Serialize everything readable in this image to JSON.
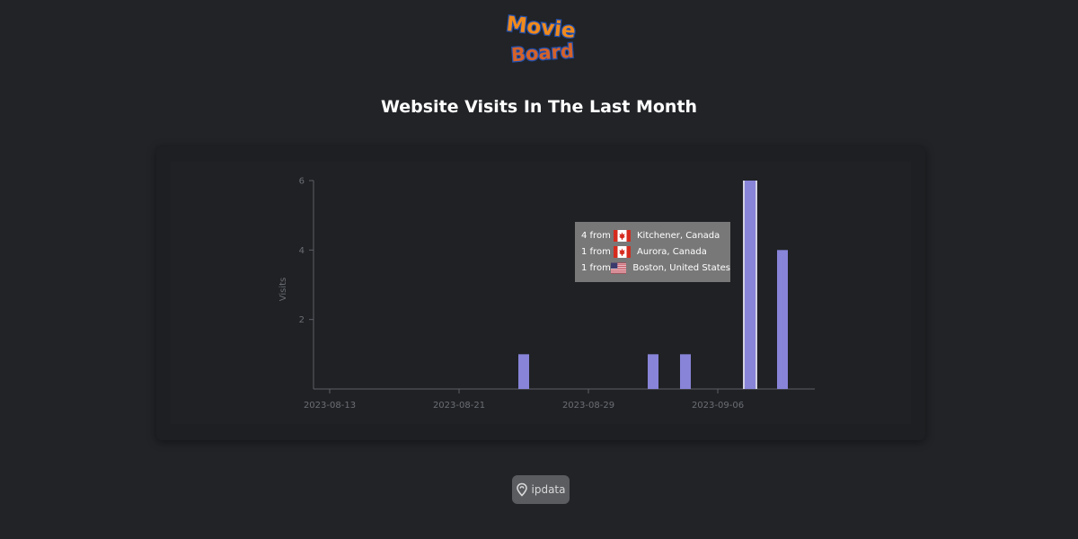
{
  "logo": {
    "line1": "Movie",
    "line2": "Board"
  },
  "page_title": "Website Visits In The Last Month",
  "chart_data": {
    "type": "bar",
    "title": "Website Visits In The Last Month",
    "xlabel": "",
    "ylabel": "Visits",
    "x_ticks": [
      "2023-08-13",
      "2023-08-21",
      "2023-08-29",
      "2023-09-06"
    ],
    "y_ticks": [
      2,
      4,
      6
    ],
    "ylim": [
      0,
      6
    ],
    "x_range": [
      "2023-08-12",
      "2023-09-12"
    ],
    "bars": [
      {
        "date": "2023-08-25",
        "value": 1
      },
      {
        "date": "2023-09-02",
        "value": 1
      },
      {
        "date": "2023-09-04",
        "value": 1
      },
      {
        "date": "2023-09-08",
        "value": 6,
        "highlighted": true
      },
      {
        "date": "2023-09-10",
        "value": 4
      }
    ],
    "bar_color": "#8884d8",
    "grid": false
  },
  "tooltip": {
    "rows": [
      {
        "count": "4 from",
        "flag": "canada-flag-icon",
        "location": "Kitchener, Canada"
      },
      {
        "count": "1 from",
        "flag": "canada-flag-icon",
        "location": "Aurora, Canada"
      },
      {
        "count": "1 from",
        "flag": "usa-flag-icon",
        "location": "Boston, United States"
      }
    ]
  },
  "footer": {
    "badge_label": "ipdata",
    "badge_icon": "location-pin-icon"
  }
}
